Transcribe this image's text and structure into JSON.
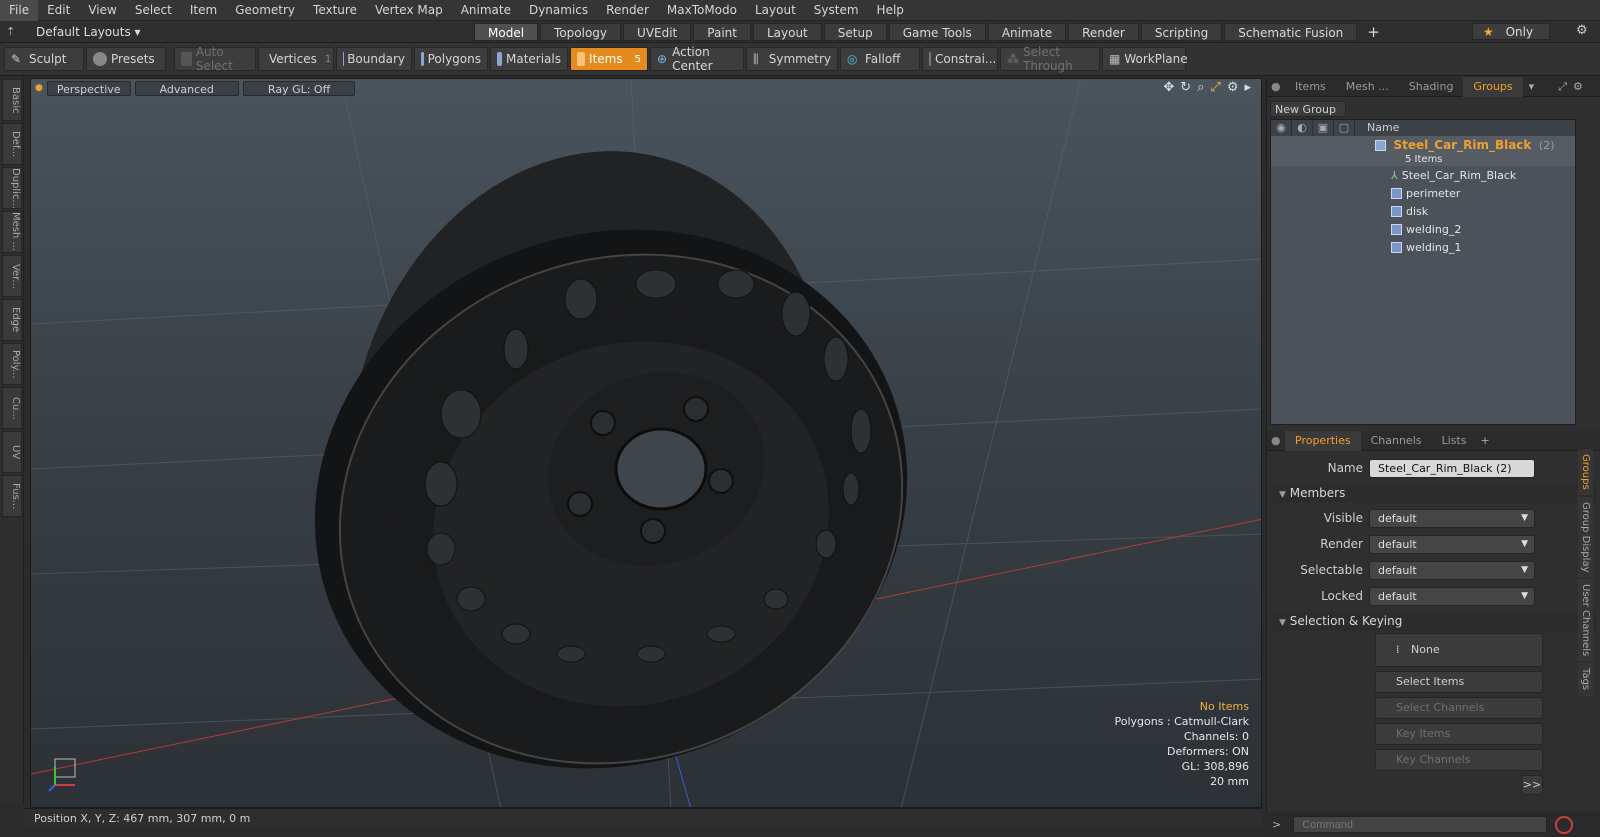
{
  "menu": [
    "File",
    "Edit",
    "View",
    "Select",
    "Item",
    "Geometry",
    "Texture",
    "Vertex Map",
    "Animate",
    "Dynamics",
    "Render",
    "MaxToModo",
    "Layout",
    "System",
    "Help"
  ],
  "layouts_label": "Default Layouts",
  "mode_tabs": [
    "Model",
    "Topology",
    "UVEdit",
    "Paint",
    "Layout",
    "Setup",
    "Game Tools",
    "Animate",
    "Render",
    "Scripting",
    "Schematic Fusion"
  ],
  "active_tab": "Model",
  "only_label": "Only",
  "toolbar": {
    "sculpt": "Sculpt",
    "presets": "Presets",
    "auto_select": "Auto Select",
    "vertices": "Vertices",
    "vertices_count": "1",
    "boundary": "Boundary",
    "polygons": "Polygons",
    "materials": "Materials",
    "items": "Items",
    "items_count": "5",
    "action_center": "Action Center",
    "symmetry": "Symmetry",
    "falloff": "Falloff",
    "constraints": "Constrai...",
    "select_through": "Select Through",
    "workplane": "WorkPlane"
  },
  "left_tabs": [
    "Basic",
    "Def...",
    "Duplic...",
    "Mesh ...",
    "Ver...",
    "Edge",
    "Poly...",
    "Cu...",
    "UV",
    "Fus..."
  ],
  "viewport": {
    "tabs": [
      "Perspective",
      "Advanced",
      "Ray GL: Off"
    ],
    "hud": [
      "No Items",
      "Polygons : Catmull-Clark",
      "Channels: 0",
      "Deformers: ON",
      "GL: 308,896",
      "20 mm"
    ]
  },
  "status": "Position X, Y, Z:  467 mm, 307 mm, 0 m",
  "top_panel_tabs": [
    "Items",
    "Mesh ...",
    "Shading",
    "Groups"
  ],
  "new_group_label": "New Group",
  "group_list": {
    "name_header": "Name",
    "group": "Steel_Car_Rim_Black",
    "group_count": "(2)",
    "group_sub": "5 Items",
    "items": [
      "Steel_Car_Rim_Black",
      "perimeter",
      "disk",
      "welding_2",
      "welding_1"
    ]
  },
  "props_tabs": [
    "Properties",
    "Channels",
    "Lists"
  ],
  "properties": {
    "name_label": "Name",
    "name_value": "Steel_Car_Rim_Black (2)",
    "members_section": "Members",
    "rows": [
      {
        "label": "Visible",
        "value": "default"
      },
      {
        "label": "Render",
        "value": "default"
      },
      {
        "label": "Selectable",
        "value": "default"
      },
      {
        "label": "Locked",
        "value": "default"
      }
    ],
    "selection_section": "Selection & Keying",
    "none_label": "None",
    "buttons": [
      "Select Items",
      "Select Channels",
      "Key Items",
      "Key Channels"
    ],
    "more": ">>"
  },
  "side_tabs": [
    "Groups",
    "Group Display",
    "User Channels",
    "Tags"
  ],
  "command_placeholder": "Command"
}
